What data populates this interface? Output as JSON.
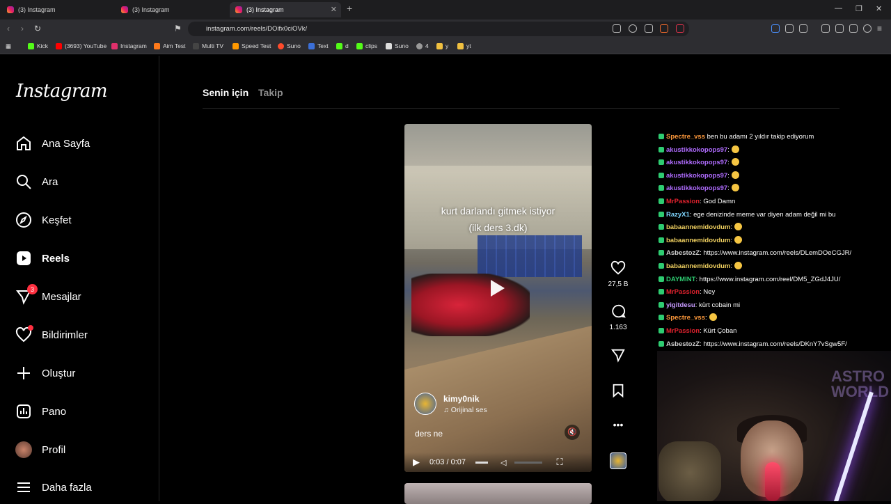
{
  "browser": {
    "tabs": [
      {
        "title": "(3) Instagram"
      },
      {
        "title": "(3) Instagram"
      },
      {
        "title": "(3) Instagram",
        "active": true
      }
    ],
    "url": "instagram.com/reels/DOifx0ciOVk/",
    "bookmarks": [
      "Kick",
      "(3693) YouTube",
      "Instagram",
      "Aim Test",
      "Multi TV",
      "Speed Test",
      "Suno",
      "Text",
      "d",
      "clips",
      "Suno",
      "4",
      "y",
      "yt"
    ]
  },
  "sidebar": {
    "logo": "Instagram",
    "items": [
      {
        "label": "Ana Sayfa",
        "icon": "home-icon"
      },
      {
        "label": "Ara",
        "icon": "search-icon"
      },
      {
        "label": "Keşfet",
        "icon": "compass-icon"
      },
      {
        "label": "Reels",
        "icon": "reels-icon",
        "active": true
      },
      {
        "label": "Mesajlar",
        "icon": "messenger-icon",
        "badge": "3"
      },
      {
        "label": "Bildirimler",
        "icon": "heart-icon"
      },
      {
        "label": "Oluştur",
        "icon": "plus-icon"
      },
      {
        "label": "Pano",
        "icon": "dashboard-icon"
      },
      {
        "label": "Profil",
        "icon": "profile-avatar"
      },
      {
        "label": "Daha fazla",
        "icon": "menu-icon"
      }
    ]
  },
  "feed": {
    "tabs": [
      "Senin için",
      "Takip"
    ],
    "video": {
      "caption_line1": "kurt darlandı gitmek istiyor",
      "caption_line2": "(ilk ders 3.dk)",
      "author": "kimy0nik",
      "sound": "Orijinal ses",
      "description": "ders ne",
      "time": "0:03 / 0:07"
    },
    "actions": {
      "likes": "27,5 B",
      "comments": "1.163"
    }
  },
  "chat": [
    {
      "user": "Spectre_vss",
      "color": "#ff9a3c",
      "text": " ben bu adamı 2 yıldır takip ediyorum"
    },
    {
      "user": "akustikkokopops97",
      "color": "#b06cff",
      "text": ":",
      "emote": true
    },
    {
      "user": "akustikkokopops97",
      "color": "#b06cff",
      "text": ":",
      "emote": true
    },
    {
      "user": "akustikkokopops97",
      "color": "#b06cff",
      "text": ":",
      "emote": true
    },
    {
      "user": "akustikkokopops97",
      "color": "#b06cff",
      "text": ":",
      "emote": true
    },
    {
      "user": "MrPassion",
      "color": "#e0222e",
      "text": ": God Damn"
    },
    {
      "user": "RazyX1",
      "color": "#7fd6ff",
      "text": ": ege denizinde meme var diyen adam değil mi bu"
    },
    {
      "user": "babaannemidovdum",
      "color": "#f0d060",
      "text": ":",
      "emote": true
    },
    {
      "user": "babaannemidovdum",
      "color": "#f0d060",
      "text": ":",
      "emote": true
    },
    {
      "user": "AsbestozZ",
      "color": "#d0d0d0",
      "text": ": https://www.instagram.com/reels/DLemDOeCGJR/"
    },
    {
      "user": "babaannemidovdum",
      "color": "#f0d060",
      "text": ":",
      "emote": true
    },
    {
      "user": "DAYMINT",
      "color": "#2ecc71",
      "text": ": https://www.instagram.com/reel/DM5_ZGdJ4JU/"
    },
    {
      "user": "MrPassion",
      "color": "#e0222e",
      "text": ": Ney"
    },
    {
      "user": "yigitdesu",
      "color": "#c79bff",
      "text": ": kürt cobain mi"
    },
    {
      "user": "Spectre_vss",
      "color": "#ff9a3c",
      "text": ":",
      "emote": true
    },
    {
      "user": "MrPassion",
      "color": "#e0222e",
      "text": ": Kürt Çoban"
    },
    {
      "user": "AsbestozZ",
      "color": "#d0d0d0",
      "text": ": https://www.instagram.com/reels/DKnY7vSgw5F/"
    }
  ],
  "webcam": {
    "poster_text": "ASTRO WORLD"
  }
}
